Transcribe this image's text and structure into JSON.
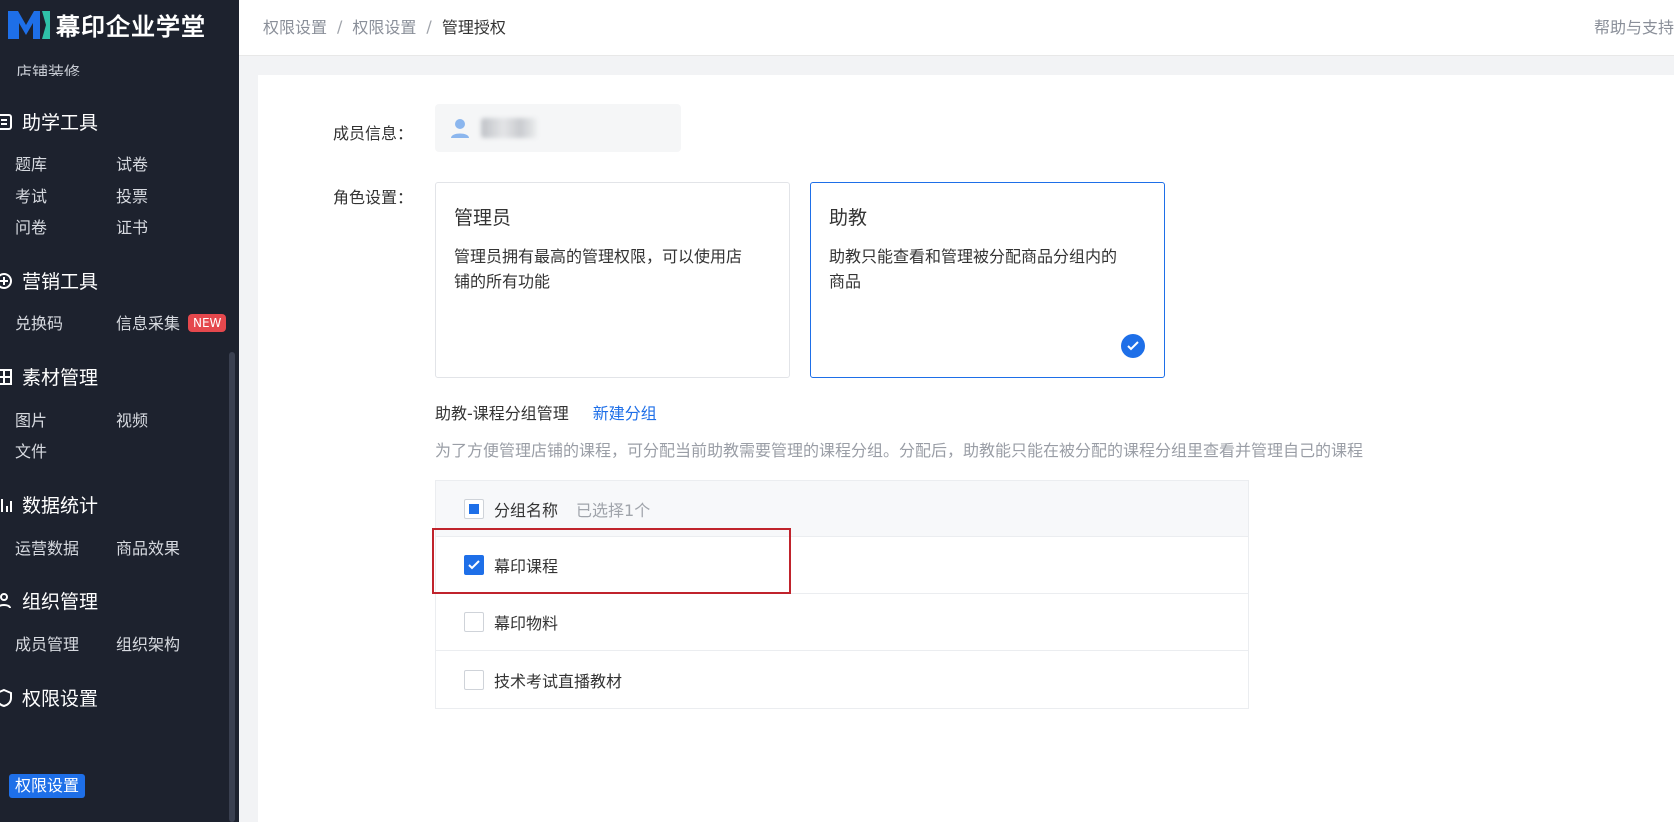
{
  "app": {
    "title": "幕印企业学堂",
    "help_label": "帮助与支持"
  },
  "colors": {
    "sidebar_bg": "#1d222e",
    "accent": "#1e6fe8",
    "badge": "#e5484d",
    "highlight": "#c0232c"
  },
  "breadcrumb": [
    "权限设置",
    "权限设置",
    "管理授权"
  ],
  "sidebar": {
    "cut_item": "店铺装修",
    "sections": [
      {
        "title": "助学工具",
        "icon": "tool-icon",
        "items": [
          "题库",
          "试卷",
          "考试",
          "投票",
          "问卷",
          "证书"
        ]
      },
      {
        "title": "营销工具",
        "icon": "marketing-icon",
        "items": [
          "兑换码",
          "信息采集"
        ],
        "badge": "NEW"
      },
      {
        "title": "素材管理",
        "icon": "material-icon",
        "items": [
          "图片",
          "视频",
          "文件"
        ]
      },
      {
        "title": "数据统计",
        "icon": "stats-icon",
        "items": [
          "运营数据",
          "商品效果"
        ]
      },
      {
        "title": "组织管理",
        "icon": "org-icon",
        "items": [
          "成员管理",
          "组织架构"
        ]
      },
      {
        "title": "权限设置",
        "icon": "shield-icon",
        "items": [
          "权限设置"
        ]
      }
    ]
  },
  "form": {
    "member_label": "成员信息：",
    "role_label": "角色设置："
  },
  "roles": [
    {
      "title": "管理员",
      "desc_line1": "管理员拥有最高的管理权限，可以使用店",
      "desc_line2": "铺的所有功能",
      "selected": false
    },
    {
      "title": "助教",
      "desc_line1": "助教只能查看和管理被分配商品分组内的",
      "desc_line2": "商品",
      "selected": true
    }
  ],
  "group": {
    "title": "助教-课程分组管理",
    "new_link": "新建分组",
    "hint": "为了方便管理店铺的课程，可分配当前助教需要管理的课程分组。分配后，助教能只能在被分配的课程分组里查看并管理自己的课程"
  },
  "table": {
    "header": "分组名称",
    "selected_count": "已选择1个",
    "rows": [
      {
        "name": "幕印课程",
        "checked": true
      },
      {
        "name": "幕印物料",
        "checked": false
      },
      {
        "name": "技术考试直播教材",
        "checked": false
      }
    ]
  }
}
